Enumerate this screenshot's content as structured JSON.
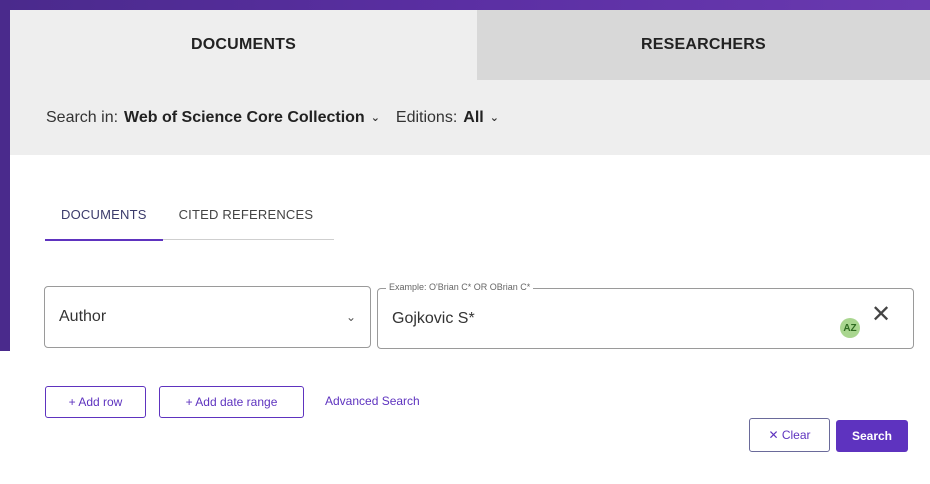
{
  "top_tabs": [
    {
      "label": "DOCUMENTS",
      "active": true
    },
    {
      "label": "RESEARCHERS",
      "active": false
    }
  ],
  "search_in": {
    "label": "Search in:",
    "collection": "Web of Science Core Collection",
    "editions_label": "Editions:",
    "editions_value": "All",
    "chevron_icon": "chevron-down-icon"
  },
  "sub_tabs": [
    {
      "label": "DOCUMENTS",
      "active": true
    },
    {
      "label": "CITED REFERENCES",
      "active": false
    }
  ],
  "query_row": {
    "field": "Author",
    "example_label": "Example: O'Brian C* OR OBrian C*",
    "value": "Gojkovic S*",
    "az_badge": "AZ",
    "clear_glyph": "✕"
  },
  "actions": {
    "add_row": "+ Add row",
    "add_date_range": "+ Add date range",
    "advanced_search": "Advanced Search",
    "clear": "✕ Clear",
    "search": "Search"
  },
  "colors": {
    "accent": "#5e33bf",
    "background_gradient": "#4a2a8c"
  }
}
